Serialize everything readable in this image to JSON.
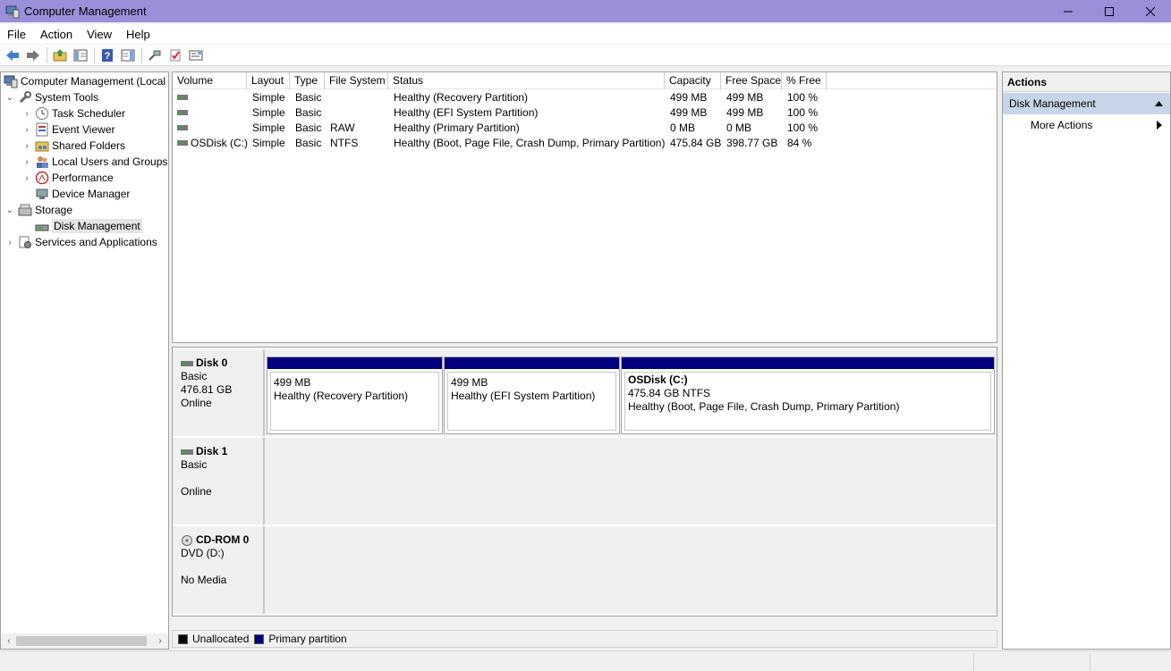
{
  "window": {
    "title": "Computer Management",
    "controls": {
      "minimize": "minimize-icon",
      "maximize": "maximize-icon",
      "close": "close-icon"
    }
  },
  "menu": [
    "File",
    "Action",
    "View",
    "Help"
  ],
  "toolbar": [
    "back-arrow-icon",
    "forward-arrow-icon",
    "up-folder-icon",
    "show-hide-tree-icon",
    "help-icon",
    "show-hide-action-pane-icon",
    "connect-icon",
    "check-icon",
    "properties-icon"
  ],
  "tree": {
    "root": "Computer Management (Local",
    "system_tools": "System Tools",
    "task_scheduler": "Task Scheduler",
    "event_viewer": "Event Viewer",
    "shared_folders": "Shared Folders",
    "local_users": "Local Users and Groups",
    "performance": "Performance",
    "device_manager": "Device Manager",
    "storage": "Storage",
    "disk_management": "Disk Management",
    "services": "Services and Applications"
  },
  "volumes": {
    "headers": [
      "Volume",
      "Layout",
      "Type",
      "File System",
      "Status",
      "Capacity",
      "Free Space",
      "% Free"
    ],
    "rows": [
      {
        "volume": "",
        "layout": "Simple",
        "type": "Basic",
        "fs": "",
        "status": "Healthy (Recovery Partition)",
        "capacity": "499 MB",
        "free": "499 MB",
        "pct": "100 %"
      },
      {
        "volume": "",
        "layout": "Simple",
        "type": "Basic",
        "fs": "",
        "status": "Healthy (EFI System Partition)",
        "capacity": "499 MB",
        "free": "499 MB",
        "pct": "100 %"
      },
      {
        "volume": "",
        "layout": "Simple",
        "type": "Basic",
        "fs": "RAW",
        "status": "Healthy (Primary Partition)",
        "capacity": "0 MB",
        "free": "0 MB",
        "pct": "100 %"
      },
      {
        "volume": "OSDisk (C:)",
        "layout": "Simple",
        "type": "Basic",
        "fs": "NTFS",
        "status": "Healthy (Boot, Page File, Crash Dump, Primary Partition)",
        "capacity": "475.84 GB",
        "free": "398.77 GB",
        "pct": "84 %"
      }
    ]
  },
  "disks": {
    "disk0": {
      "name": "Disk 0",
      "type": "Basic",
      "size": "476.81 GB",
      "state": "Online",
      "partitions": [
        {
          "name": "",
          "size": "499 MB",
          "status": "Healthy (Recovery Partition)"
        },
        {
          "name": "",
          "size": "499 MB",
          "status": "Healthy (EFI System Partition)"
        },
        {
          "name": "OSDisk  (C:)",
          "size": "475.84 GB NTFS",
          "status": "Healthy (Boot, Page File, Crash Dump, Primary Partition)"
        }
      ]
    },
    "disk1": {
      "name": "Disk 1",
      "type": "Basic",
      "size": "",
      "state": "Online"
    },
    "cdrom0": {
      "name": "CD-ROM 0",
      "type": "DVD (D:)",
      "size": "",
      "state": "No Media"
    }
  },
  "legend": {
    "unallocated": "Unallocated",
    "primary": "Primary partition",
    "colors": {
      "unallocated": "#000000",
      "primary": "#000080"
    }
  },
  "actions": {
    "title": "Actions",
    "group": "Disk Management",
    "more": "More Actions"
  },
  "colors": {
    "titlebar": "#9a8fd9",
    "selection": "#c6d6e8",
    "partition_bar": "#000080"
  }
}
